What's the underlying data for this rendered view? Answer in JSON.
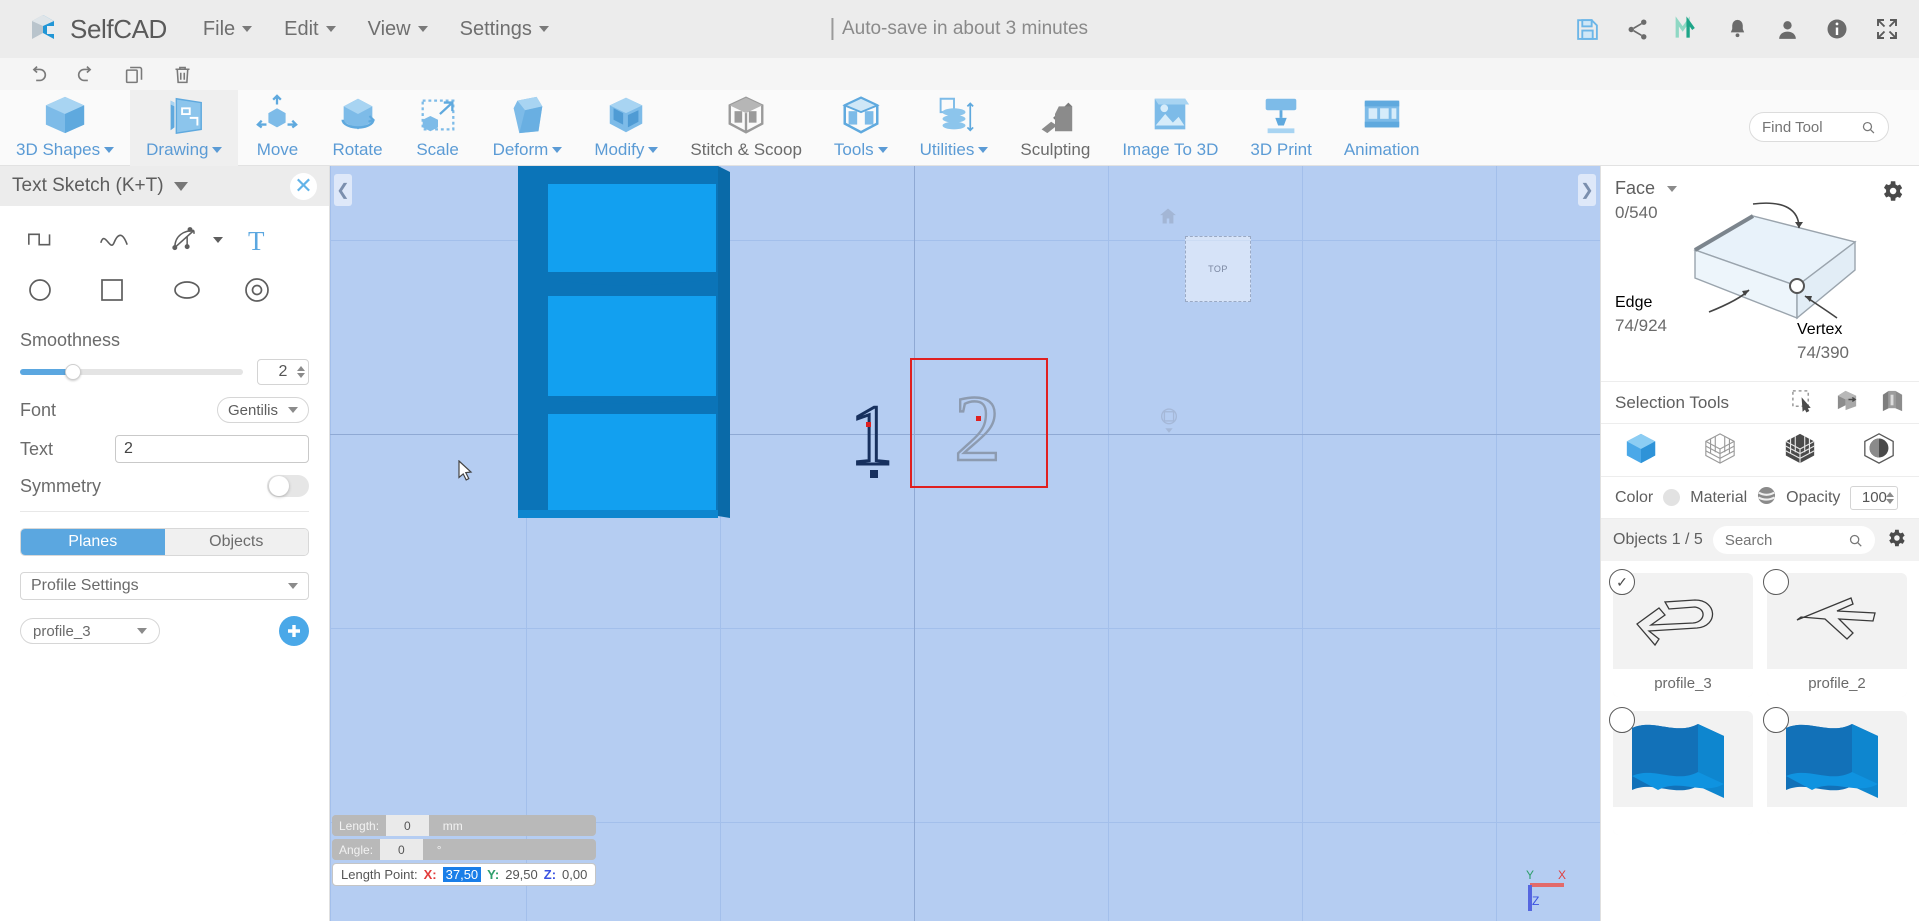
{
  "app": {
    "brand": "SelfCAD",
    "autosave_text": "Auto-save in about 3 minutes"
  },
  "menu": [
    {
      "label": "File"
    },
    {
      "label": "Edit"
    },
    {
      "label": "View"
    },
    {
      "label": "Settings"
    }
  ],
  "top_icons": [
    {
      "name": "save-icon",
      "title": "Save"
    },
    {
      "name": "share-icon",
      "title": "Share"
    },
    {
      "name": "m-logo-icon",
      "title": "M"
    },
    {
      "name": "notifications-bell-icon",
      "title": "Notifications"
    },
    {
      "name": "user-account-icon",
      "title": "Account"
    },
    {
      "name": "info-icon",
      "title": "Info"
    },
    {
      "name": "fullscreen-icon",
      "title": "Fullscreen"
    }
  ],
  "quick_actions": [
    {
      "name": "undo-button",
      "title": "Undo"
    },
    {
      "name": "redo-button",
      "title": "Redo"
    },
    {
      "name": "duplicate-button",
      "title": "Duplicate"
    },
    {
      "name": "delete-button",
      "title": "Delete"
    }
  ],
  "ribbon": {
    "items": [
      {
        "label": "3D Shapes",
        "caret": true,
        "active": false,
        "gray": false
      },
      {
        "label": "Drawing",
        "caret": true,
        "active": true,
        "gray": false
      },
      {
        "label": "Move",
        "caret": false,
        "active": false,
        "gray": false
      },
      {
        "label": "Rotate",
        "caret": false,
        "active": false,
        "gray": false
      },
      {
        "label": "Scale",
        "caret": false,
        "active": false,
        "gray": false
      },
      {
        "label": "Deform",
        "caret": true,
        "active": false,
        "gray": false
      },
      {
        "label": "Modify",
        "caret": true,
        "active": false,
        "gray": false
      },
      {
        "label": "Stitch & Scoop",
        "caret": false,
        "active": false,
        "gray": true
      },
      {
        "label": "Tools",
        "caret": true,
        "active": false,
        "gray": false
      },
      {
        "label": "Utilities",
        "caret": true,
        "active": false,
        "gray": false
      },
      {
        "label": "Sculpting",
        "caret": false,
        "active": false,
        "gray": true
      },
      {
        "label": "Image To 3D",
        "caret": false,
        "active": false,
        "gray": false
      },
      {
        "label": "3D Print",
        "caret": false,
        "active": false,
        "gray": false
      },
      {
        "label": "Animation",
        "caret": false,
        "active": false,
        "gray": false
      }
    ],
    "find_tool_placeholder": "Find Tool"
  },
  "left_panel": {
    "title": "Text Sketch (K+T)",
    "shapes": [
      {
        "name": "polyline-tool-icon"
      },
      {
        "name": "spline-tool-icon"
      },
      {
        "name": "arc-tool-icon"
      },
      {
        "name": "text-tool-icon"
      },
      {
        "name": "circle-tool-icon"
      },
      {
        "name": "rectangle-tool-icon"
      },
      {
        "name": "ellipse-tool-icon"
      },
      {
        "name": "ring-tool-icon"
      }
    ],
    "smoothness": {
      "label": "Smoothness",
      "value": "2"
    },
    "font": {
      "label": "Font",
      "value": "Gentilis"
    },
    "text": {
      "label": "Text",
      "value": "2"
    },
    "symmetry": {
      "label": "Symmetry",
      "enabled": false
    },
    "tabs": [
      {
        "label": "Planes",
        "active": true
      },
      {
        "label": "Objects",
        "active": false
      }
    ],
    "profile_settings": "Profile Settings",
    "profile_selected": "profile_3"
  },
  "viewport": {
    "plane_label": "TOP",
    "sketch_items": [
      {
        "label": "1",
        "state": "committed"
      },
      {
        "label": "2",
        "state": "preview-selected"
      }
    ],
    "axis_gizmo": {
      "x": "X",
      "y": "Y",
      "z": "Z"
    },
    "status": {
      "length": {
        "label": "Length:",
        "value": "0",
        "unit": "mm"
      },
      "angle": {
        "label": "Angle:",
        "value": "0",
        "unit": "°"
      },
      "length_point": {
        "label": "Length Point:",
        "x_label": "X:",
        "x_value": "37,50",
        "y_label": "Y:",
        "y_value": "29,50",
        "z_label": "Z:",
        "z_value": "0,00"
      }
    }
  },
  "right_panel": {
    "selection": {
      "face_label": "Face",
      "face_count": "0/540",
      "edge_label": "Edge",
      "edge_count": "74/924",
      "vertex_label": "Vertex",
      "vertex_count": "74/390"
    },
    "selection_tools_label": "Selection Tools",
    "selection_tool_icons": [
      {
        "name": "rectangle-select-icon"
      },
      {
        "name": "box-select-icon"
      },
      {
        "name": "through-select-icon"
      }
    ],
    "mode_icons": [
      {
        "name": "solid-shading-mode-icon",
        "active": true
      },
      {
        "name": "wireframe-shading-mode-icon",
        "active": false
      },
      {
        "name": "grid-shading-mode-icon",
        "active": false
      },
      {
        "name": "shaded-sphere-mode-icon",
        "active": false
      }
    ],
    "material_row": {
      "color_label": "Color",
      "material_label": "Material",
      "opacity_label": "Opacity",
      "opacity_value": "100"
    },
    "objects_header": {
      "title": "Objects 1 / 5",
      "search_placeholder": "Search"
    },
    "objects": [
      {
        "name": "profile_3",
        "selected": true,
        "thumb": "profile-outline"
      },
      {
        "name": "profile_2",
        "selected": false,
        "thumb": "profile-outline-2"
      },
      {
        "name": "",
        "selected": false,
        "thumb": "solid-blue"
      },
      {
        "name": "",
        "selected": false,
        "thumb": "solid-blue"
      }
    ]
  },
  "colors": {
    "accent_blue": "#5ba7e0",
    "viewport_bg": "#b5cdf2",
    "model_blue": "#12a0f0",
    "selection_red": "#e02020",
    "brand_teal": "#27b99a"
  }
}
